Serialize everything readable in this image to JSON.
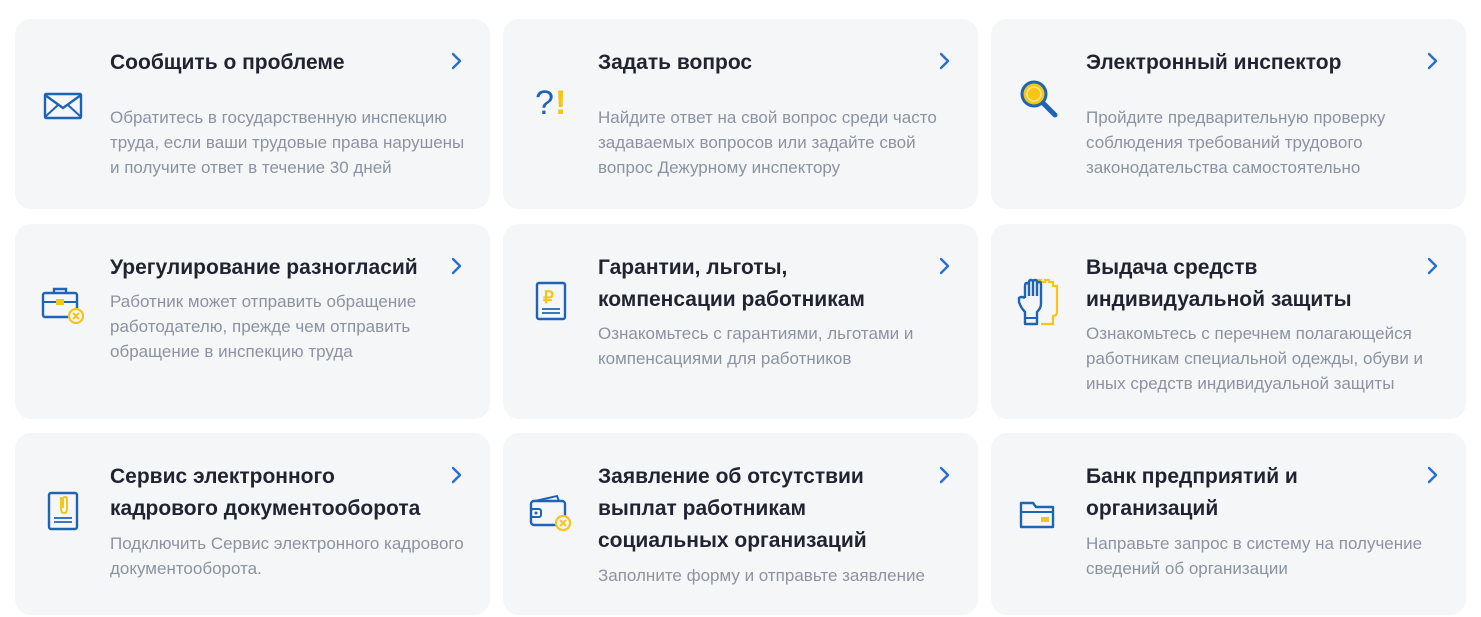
{
  "cards": [
    {
      "title": "Сообщить о проблеме",
      "description": "Обратитесь в государственную инспекцию труда, если ваши трудовые права нарушены и получите ответ в течение 30 дней",
      "icon": "envelope-icon"
    },
    {
      "title": "Задать вопрос",
      "description": "Найдите ответ на свой вопрос среди часто задаваемых вопросов или задайте свой вопрос Дежурному инспектору",
      "icon": "question-exclamation-icon"
    },
    {
      "title": "Электронный инспектор",
      "description": "Пройдите предварительную проверку соблюдения требований трудового законодательства самостоятельно",
      "icon": "magnifier-icon"
    },
    {
      "title": "Урегулирование разногласий",
      "description": "Работник может отправить обращение работодателю, прежде чем отправить обращение в инспекцию труда",
      "icon": "briefcase-icon"
    },
    {
      "title": "Гарантии, льготы, компенсации работникам",
      "description": "Ознакомьтесь с гарантиями, льготами и компенсациями для работников",
      "icon": "ruble-document-icon"
    },
    {
      "title": "Выдача средств индивидуальной защиты",
      "description": "Ознакомьтесь с перечнем полагающейся работникам специальной одежды, обуви и иных средств индивидуальной защиты",
      "icon": "gloves-icon"
    },
    {
      "title": "Сервис электронного кадрового документооборота",
      "description": "Подключить Сервис электронного кадрового документооборота.",
      "icon": "clip-document-icon"
    },
    {
      "title": "Заявление об отсутствии выплат работникам социальных организаций",
      "description": "Заполните форму и отправьте заявление",
      "icon": "wallet-icon"
    },
    {
      "title": "Банк предприятий и организаций",
      "description": "Направьте запрос в систему на получение сведений об организации",
      "icon": "folder-icon"
    }
  ],
  "colors": {
    "card_bg": "#f5f6f8",
    "title": "#1f2430",
    "description": "#8b93a1",
    "icon_blue": "#1f64b4",
    "icon_yellow": "#f5c518",
    "arrow": "#2a6fcf"
  }
}
